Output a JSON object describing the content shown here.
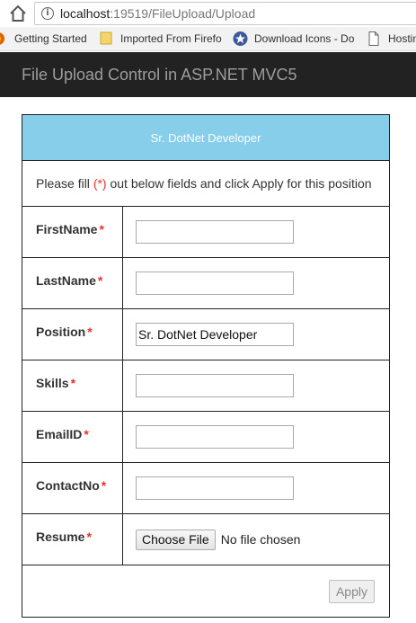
{
  "browser": {
    "url_host": "localhost",
    "url_path": ":19519/FileUpload/Upload",
    "bookmarks": [
      {
        "label": "Getting Started",
        "icon": "firefox-icon"
      },
      {
        "label": "Imported From Firefo",
        "icon": "folder-icon"
      },
      {
        "label": "Download Icons - Do",
        "icon": "star-badge-icon"
      },
      {
        "label": "Hostin",
        "icon": "page-icon"
      }
    ]
  },
  "navbar": {
    "brand": "File Upload Control in ASP.NET MVC5"
  },
  "form": {
    "header": "Sr. DotNet Developer",
    "note_pre": "Please fill ",
    "note_req": "(*)",
    "note_post": " out below fields and click Apply for this position",
    "required_mark": "*",
    "fields": [
      {
        "label": "FirstName",
        "value": ""
      },
      {
        "label": "LastName",
        "value": ""
      },
      {
        "label": "Position",
        "value": "Sr. DotNet Developer"
      },
      {
        "label": "Skills",
        "value": ""
      },
      {
        "label": "EmailID",
        "value": ""
      },
      {
        "label": "ContactNo",
        "value": ""
      }
    ],
    "resume": {
      "label": "Resume",
      "button": "Choose File",
      "status": "No file chosen"
    },
    "apply_label": "Apply"
  },
  "colors": {
    "header_bg": "#87ceeb",
    "navbar_bg": "#222222",
    "required": "#e8312f"
  }
}
